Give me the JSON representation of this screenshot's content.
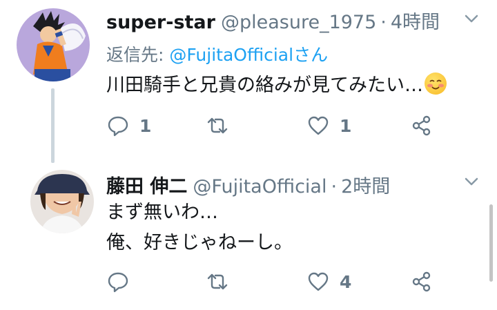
{
  "tweets": [
    {
      "name": "super-star",
      "handle": "@pleasure_1975",
      "separator": "·",
      "time": "4時間",
      "reply_prefix": "返信先:",
      "reply_mention": "@FujitaOfficialさん",
      "lines": [
        "川田騎手と兄貴の絡みが見てみたい…"
      ],
      "emoji": "smiling-blushing-face-emoji",
      "replies": "1",
      "retweets": "",
      "likes": "1"
    },
    {
      "name": "藤田 伸二",
      "handle": "@FujitaOfficial",
      "separator": "·",
      "time": "2時間",
      "lines": [
        "まず無いわ…",
        "俺、好きじゃねーし。"
      ],
      "replies": "",
      "retweets": "",
      "likes": "4"
    }
  ],
  "colors": {
    "text": "#14171a",
    "secondary": "#657786",
    "link": "#1da1f2",
    "thread_line": "#ccd6dd"
  }
}
